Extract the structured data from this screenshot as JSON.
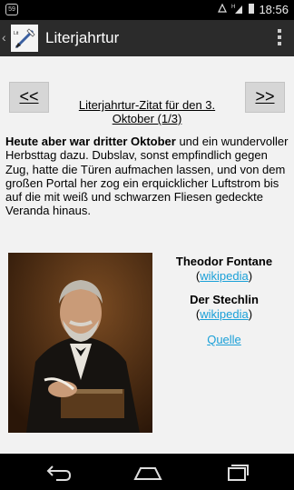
{
  "status_bar": {
    "notification_icon": "notification-icon",
    "time": "18:56"
  },
  "action_bar": {
    "title": "Literjahrtur",
    "app_icon": "literjahrtur-app-icon"
  },
  "quote": {
    "prev_label": "<<",
    "next_label": ">>",
    "title": "Literjahrtur-Zitat für den 3. Oktober (1/3)",
    "text_bold": "Heute aber war dritter Oktober",
    "text_rest": " und ein wundervoller Herbsttag dazu. Dubslav, sonst empfindlich gegen Zug, hatte die Türen aufmachen lassen, und von dem großen Portal her zog ein erquicklicher Luftstrom bis auf die mit weiß und schwarzen Fliesen gedeckte Veranda hinaus."
  },
  "author": {
    "name": "Theodor Fontane",
    "name_link": "wikipedia",
    "work": "Der Stechlin",
    "work_link": "wikipedia",
    "source": "Quelle"
  },
  "colors": {
    "link": "#1aa0d8",
    "content_bg": "#f2f2f2",
    "action_bar_bg": "#2b2b2b"
  }
}
